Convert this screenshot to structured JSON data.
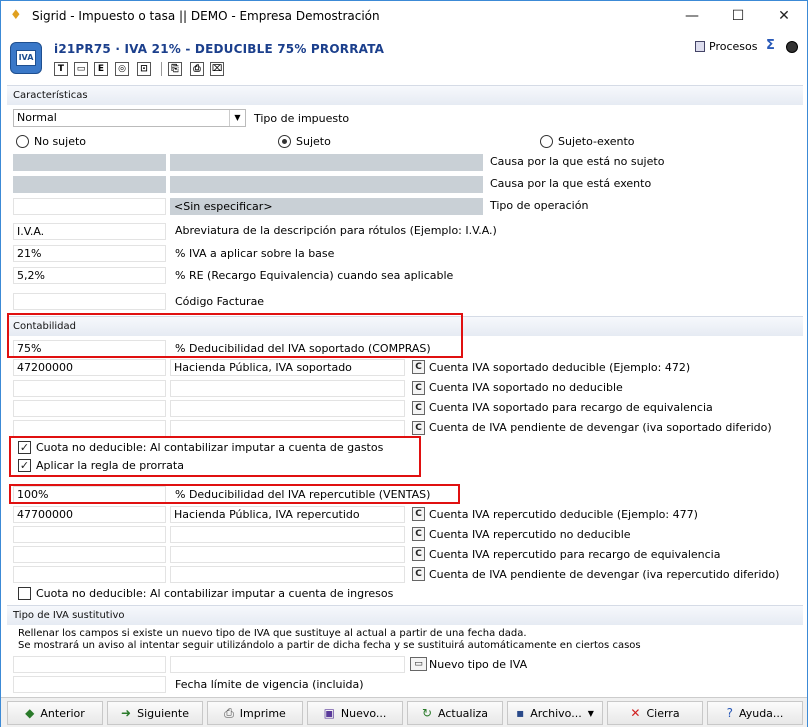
{
  "window": {
    "title": "Sigrid - Impuesto o tasa || DEMO - Empresa Demostración",
    "minimize": "—",
    "maximize": "☐",
    "close": "✕"
  },
  "header": {
    "icon_text": "IVA",
    "title": "i21PR75 · IVA 21% - DEDUCIBLE 75% PRORRATA",
    "procesos": "Procesos",
    "sigma": "Σ",
    "toolbar": [
      "T",
      "▭",
      "E",
      "◎",
      "⊡",
      "⎘",
      "⎙",
      "⌧"
    ]
  },
  "caracteristicas": {
    "section_title": "Características",
    "tipo_select": "Normal",
    "tipo_label": "Tipo de impuesto",
    "radio_no_sujeto": "No sujeto",
    "radio_sujeto": "Sujeto",
    "radio_exento": "Sujeto-exento",
    "causa_no_sujeto_label": "Causa por la que está no sujeto",
    "causa_exento_label": "Causa por la que está exento",
    "tipo_operacion_value": "<Sin especificar>",
    "tipo_operacion_label": "Tipo de operación",
    "abreviatura_value": "I.V.A.",
    "abreviatura_label": "Abreviatura de la descripción para rótulos (Ejemplo: I.V.A.)",
    "iva_value": "21%",
    "iva_label": "% IVA a aplicar sobre la base",
    "re_value": "5,2%",
    "re_label": "% RE (Recargo Equivalencia) cuando sea aplicable",
    "facturae_label": "Código Facturae"
  },
  "contabilidad": {
    "section_title": "Contabilidad",
    "ded_soportado_value": "75%",
    "ded_soportado_label": "% Deducibilidad del IVA soportado (COMPRAS)",
    "cta_sop_ded_value": "47200000",
    "cta_sop_ded_desc": "Hacienda Pública, IVA soportado",
    "cta_sop_ded_label": "Cuenta IVA soportado deducible (Ejemplo: 472)",
    "cta_sop_noded_label": "Cuenta IVA soportado no deducible",
    "cta_sop_re_label": "Cuenta IVA soportado para recargo de equivalencia",
    "cta_sop_pend_label": "Cuenta de IVA pendiente de devengar (iva soportado diferido)",
    "chk_cuota_gastos": "Cuota no deducible: Al contabilizar imputar a cuenta de gastos",
    "chk_prorrata": "Aplicar la regla de prorrata",
    "ded_repercutido_value": "100%",
    "ded_repercutido_label": "% Deducibilidad del IVA repercutible (VENTAS)",
    "cta_rep_ded_value": "47700000",
    "cta_rep_ded_desc": "Hacienda Pública, IVA repercutido",
    "cta_rep_ded_label": "Cuenta IVA repercutido deducible (Ejemplo: 477)",
    "cta_rep_noded_label": "Cuenta IVA repercutido no deducible",
    "cta_rep_re_label": "Cuenta IVA repercutido para recargo de equivalencia",
    "cta_rep_pend_label": "Cuenta de IVA pendiente de devengar (iva repercutido diferido)",
    "chk_cuota_ingresos": "Cuota no deducible: Al contabilizar imputar a cuenta de ingresos",
    "c_button": "C"
  },
  "sustitutivo": {
    "section_title": "Tipo de IVA sustitutivo",
    "note1": "Rellenar los campos si existe un nuevo tipo de IVA que sustituye al actual a partir de una fecha dada.",
    "note2": "Se mostrará un aviso al intentar seguir utilizándolo a partir de dicha fecha y se sustituirá automáticamente en ciertos casos",
    "nuevo_tipo_label": "Nuevo tipo de IVA",
    "fecha_label": "Fecha límite de vigencia (incluida)"
  },
  "buttons": {
    "anterior": "Anterior",
    "siguiente": "Siguiente",
    "imprime": "Imprime",
    "nuevo": "Nuevo...",
    "actualiza": "Actualiza",
    "archivo": "Archivo...",
    "cierra": "Cierra",
    "ayuda": "Ayuda..."
  }
}
